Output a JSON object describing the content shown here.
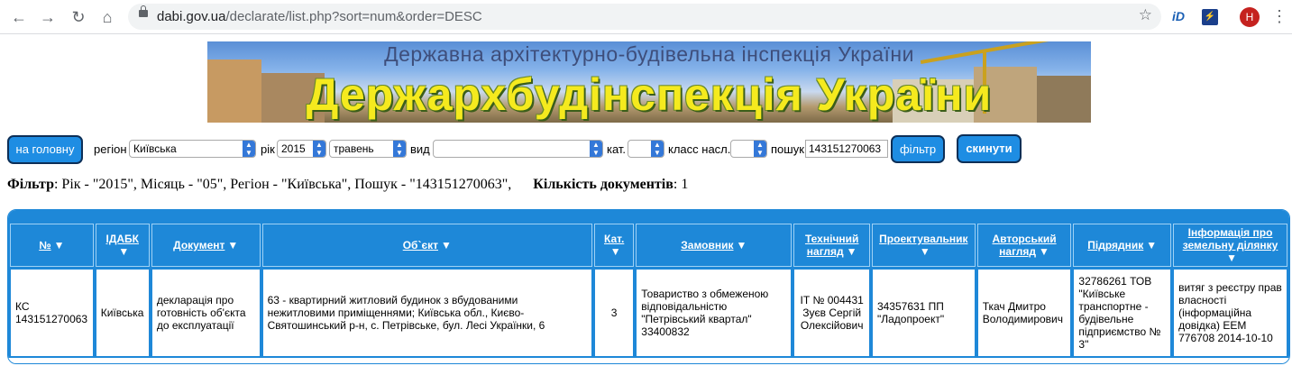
{
  "browser": {
    "url_host": "dabi.gov.ua",
    "url_path": "/declarate/list.php?sort=num&order=DESC",
    "avatar_letter": "H",
    "ext1": "iD"
  },
  "banner": {
    "subtitle": "Державна архітектурно-будівельна інспекція України",
    "title": "Держархбудінспекція України"
  },
  "filters": {
    "home_button": "на головну",
    "region_label": "регіон",
    "region_value": "Київська",
    "year_label": "рік",
    "year_value": "2015",
    "month_value": "травень",
    "type_label": "вид",
    "type_value": "",
    "cat_label": "кат.",
    "cat_value": "",
    "class_label": "класс насл.",
    "class_value": "",
    "search_label": "пошук",
    "search_value": "143151270063",
    "filter_button": "фільтр",
    "reset_button": "скинути"
  },
  "summary": {
    "filter_label": "Фільтр",
    "filter_text": ": Рік - \"2015\", Місяць - \"05\", Регіон - \"Київська\", Пошук - \"143151270063\",",
    "count_label": "Кількість документів",
    "count_value": ": 1"
  },
  "table": {
    "headers": [
      "№",
      "ІДАБК",
      "Документ",
      "Об`єкт",
      "Кат.",
      "Замовник",
      "Технічний нагляд",
      "Проектувальник",
      "Авторський нагляд",
      "Підрядник",
      "Інформація про земельну ділянку"
    ],
    "row": [
      "КС 143151270063",
      "Київська",
      "декларація про готовність об'єкта до експлуатації",
      "63 - квартирний житловий будинок з вбудованими нежитловими приміщеннями; Київська обл., Києво-Святошинський р-н, с. Петрівське, бул. Лесі Українки, 6",
      "3",
      "Товариство з обмеженою відповідальністю \"Петрівський квартал\" 33400832",
      "ІТ № 004431 Зуєв Сергій Олексійович",
      "34357631 ПП \"Ладопроект\"",
      "Ткач Дмитро Володимирович",
      "32786261 ТОВ \"Київське транспортне - будівельне підприємство № 3\"",
      "витяг з реєстру прав власності (інформаційна довідка) ЕЕМ 776708 2014-10-10"
    ]
  }
}
